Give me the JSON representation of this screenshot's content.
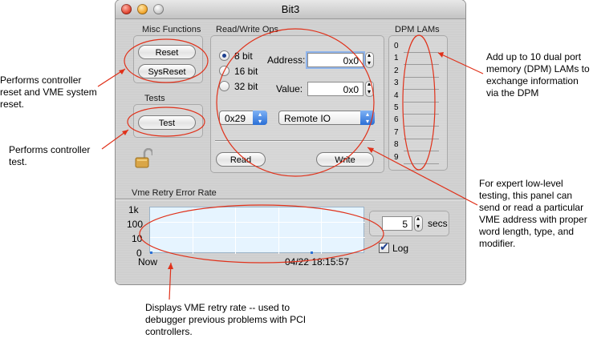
{
  "window": {
    "title": "Bit3"
  },
  "misc": {
    "label": "Misc Functions",
    "reset": "Reset",
    "sysreset": "SysReset"
  },
  "tests": {
    "label": "Tests",
    "test": "Test"
  },
  "rw": {
    "label": "Read/Write Ops",
    "sizes": [
      "8 bit",
      "16 bit",
      "32 bit"
    ],
    "selected_size": "8 bit",
    "address_label": "Address:",
    "address_value": "0x0",
    "value_label": "Value:",
    "value_value": "0x0",
    "modifier": "0x29",
    "type": "Remote IO",
    "read": "Read",
    "write": "Write"
  },
  "dpm": {
    "label": "DPM LAMs",
    "slots": [
      "0",
      "1",
      "2",
      "3",
      "4",
      "5",
      "6",
      "7",
      "8",
      "9"
    ]
  },
  "retry": {
    "label": "Vme Retry Error Rate",
    "y_ticks": [
      "1k",
      "100",
      "10",
      "0"
    ],
    "x_start": "Now",
    "x_time": "04/22 18:15:57",
    "interval": "5",
    "interval_unit": "secs",
    "log_label": "Log",
    "log_checked": true
  },
  "chart_data": {
    "type": "line",
    "title": "Vme Retry Error Rate",
    "xlabel": "",
    "ylabel": "",
    "log_scale": true,
    "ytick_labels": [
      "1k",
      "100",
      "10",
      "0"
    ],
    "xtick_labels": [
      "Now",
      "04/22 18:15:57"
    ],
    "series": [],
    "grid": true
  },
  "annotations": {
    "misc": "Performs controller reset and VME system reset.",
    "test": "Performs controller test.",
    "dpm": "Add up to 10 dual port memory (DPM) LAMs to exchange information via the DPM",
    "rw": "For expert low-level testing, this panel can send or read a particular VME address with proper word length, type, and modifier.",
    "retry": "Displays VME retry rate -- used to debugger previous problems with PCI controllers."
  },
  "colors": {
    "annotation": "#e0311a",
    "plot_bg": "#e6f4ff",
    "accent": "#2a6fd6"
  },
  "icons": {
    "lock": "padlock-open-icon",
    "checkbox": "checkmark"
  }
}
